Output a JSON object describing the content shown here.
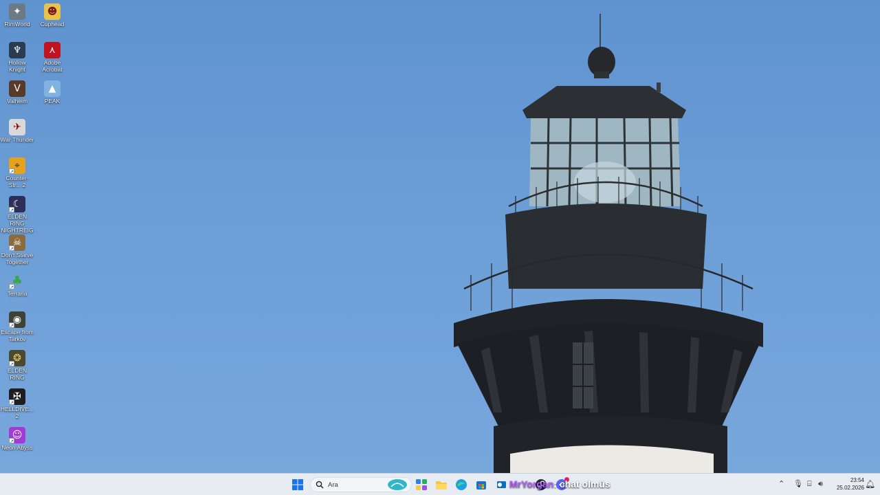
{
  "desktop": {
    "icons": [
      {
        "label": "RimWorld",
        "icon": "rimworld-icon",
        "color": "#6d7a86"
      },
      {
        "label": "Cuphead",
        "icon": "cuphead-icon",
        "color": "#e8c24a"
      },
      {
        "label": "Hollow Knight",
        "icon": "hollow-knight-icon",
        "color": "#2c3a52"
      },
      {
        "label": "Adobe Acrobat",
        "icon": "adobe-acrobat-icon",
        "color": "#c1121f"
      },
      {
        "label": "Valheim",
        "icon": "valheim-icon",
        "color": "#5a3a26"
      },
      {
        "label": "PEAK",
        "icon": "peak-icon",
        "color": "#7fb2e0"
      },
      {
        "label": "War Thunder",
        "icon": "war-thunder-icon",
        "color": "#d9d9d9"
      },
      {
        "label": "Counter-Str... 2",
        "icon": "counter-strike-2-icon",
        "color": "#e6a21a"
      },
      {
        "label": "ELDEN RING NIGHTREIGN",
        "icon": "elden-ring-nightreign-icon",
        "color": "#2b2f5a"
      },
      {
        "label": "Don't Starve Together",
        "icon": "dont-starve-together-icon",
        "color": "#8c6a3e"
      },
      {
        "label": "Terraria",
        "icon": "terraria-icon",
        "color": "#3aa64a"
      },
      {
        "label": "Escape from Tarkov",
        "icon": "escape-from-tarkov-icon",
        "color": "#3d4336"
      },
      {
        "label": "ELDEN RING",
        "icon": "elden-ring-icon",
        "color": "#4b4a2e"
      },
      {
        "label": "HELLDIVE... 2",
        "icon": "helldivers-2-icon",
        "color": "#1e1e1e"
      },
      {
        "label": "Neon Abyss",
        "icon": "neon-abyss-icon",
        "color": "#a33ad6"
      }
    ]
  },
  "taskbar": {
    "search_label": "Ara",
    "clock_time": "23:54",
    "clock_date": "25.02.2026",
    "chat_overlay_user": "MrYorgan",
    "chat_overlay_message": ": chat olmüs",
    "chat_overlay_user_color": "#b45cff",
    "pinned": [
      {
        "icon": "windows-start-icon"
      },
      {
        "icon": "search-icon"
      },
      {
        "icon": "widgets-icon"
      },
      {
        "icon": "copilot-icon"
      },
      {
        "icon": "file-explorer-icon"
      },
      {
        "icon": "edge-icon"
      },
      {
        "icon": "microsoft-store-icon"
      },
      {
        "icon": "outlook-icon"
      },
      {
        "icon": "steam-icon"
      },
      {
        "icon": "discord-icon"
      }
    ],
    "tray": [
      {
        "icon": "chevron-up-icon"
      },
      {
        "icon": "microphone-icon"
      },
      {
        "icon": "network-icon"
      },
      {
        "icon": "volume-icon"
      },
      {
        "icon": "notification-icon"
      }
    ]
  },
  "colors": {
    "sky_top": "#5f93cf",
    "sky_bottom": "#79a8dd",
    "taskbar_bg": "#e6ecf2",
    "windows_blue": "#1a73e8"
  }
}
